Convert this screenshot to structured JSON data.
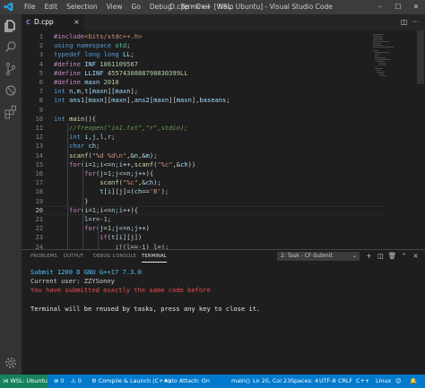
{
  "titlebar": {
    "menu": [
      "File",
      "Edit",
      "Selection",
      "View",
      "Go",
      "Debug",
      "Terminal",
      "Help"
    ],
    "window_title": "D.cpp - C++ [WSL: Ubuntu] - Visual Studio Code",
    "minimize": "–",
    "maximize": "☐",
    "close": "✕"
  },
  "activitybar": {
    "icons": [
      "files-icon",
      "search-icon",
      "source-control-icon",
      "debug-icon",
      "extensions-icon",
      "settings-gear-icon"
    ]
  },
  "tab": {
    "lang_tag": "C",
    "file_name": "D.cpp",
    "close": "×",
    "split_icon": "◫",
    "more_icon": "···"
  },
  "editor": {
    "current_line": 20,
    "line_numbers": [
      "1",
      "2",
      "3",
      "4",
      "5",
      "6",
      "7",
      "8",
      "9",
      "10",
      "11",
      "12",
      "13",
      "14",
      "15",
      "16",
      "17",
      "18",
      "19",
      "20",
      "21",
      "22",
      "23",
      "24"
    ],
    "code_lines": [
      "#include<bits/stdc++.h>",
      "using namespace std;",
      "typedef long long LL;",
      "#define INF 1061109567",
      "#define LLINF 4557430888798830399LL",
      "#define maxn 2010",
      "int n,m,t[maxn][maxn];",
      "int ans1[maxn][maxn],ans2[maxn][maxn],baseans;",
      "",
      "int main(){",
      "    //freopen(\"in1.txt\",\"r\",stdin);",
      "    int i,j,l,r;",
      "    char ch;",
      "    scanf(\"%d %d\\n\",&n,&m);",
      "    for(i=1;i<=n;i++,scanf(\"%c\",&ch))",
      "        for(j=1;j<=n;j++){",
      "            scanf(\"%c\",&ch);",
      "            t[i][j]=(ch=='B');",
      "        }",
      "    for(i=1;i<=n;i++){",
      "        l=r=-1;",
      "        for(j=1;j<=n;j++)",
      "            if(t[i][j])",
      "                if(l==-1) l=j;"
    ]
  },
  "panel": {
    "tabs": [
      "PROBLEMS",
      "OUTPUT",
      "DEBUG CONSOLE",
      "TERMINAL"
    ],
    "active_tab": "TERMINAL",
    "task_select": "2: Task - CF-Submit",
    "tool_icons": [
      "plus-icon",
      "split-icon",
      "trash-icon",
      "chevron-up-icon",
      "close-icon"
    ],
    "terminal_lines": [
      {
        "text": "Submit 1200 D GNU G++17 7.3.0",
        "color": "#4fc1ff"
      },
      {
        "text": "Current user: ZZYSonny",
        "color": "#cccccc"
      },
      {
        "text": "You have submitted exactly the same code before",
        "color": "#f14c4c"
      },
      {
        "text": "",
        "color": "#cccccc"
      },
      {
        "text": "Terminal will be reused by tasks, press any key to close it.",
        "color": "#e5e5e5"
      }
    ]
  },
  "statusbar": {
    "remote": "WSL: Ubuntu",
    "errors": "0",
    "warnings": "0",
    "launch": "Compile & Launch (C++)",
    "auto_attach": "Auto Attach: On",
    "function": "main()",
    "position": "Ln 20, Col 23",
    "spaces": "Spaces: 4",
    "encoding": "UTF-8",
    "eol": "CRLF",
    "language": "C++",
    "os": "Linux"
  },
  "colors": {
    "statusbar": "#007acc",
    "remote": "#16825d",
    "titlebar": "#3c3c3c",
    "editor_bg": "#1e1e1e"
  }
}
